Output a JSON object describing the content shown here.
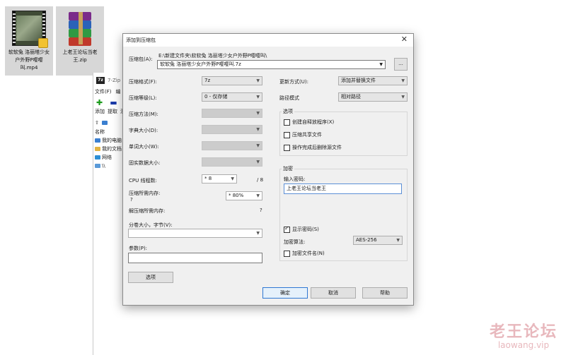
{
  "desktop": {
    "icons": [
      {
        "label": "软软兔 洛丽塔少女户外野P嘤嘤叫.mp4",
        "type": "video-file-icon"
      },
      {
        "label": "上老王论坛当老王.zip",
        "type": "winrar-archive-icon"
      }
    ]
  },
  "zip_window": {
    "title": "7-Zip",
    "menu": [
      "文件(F)",
      "编"
    ],
    "toolbar_labels": [
      "添加",
      "提取",
      "测"
    ],
    "address": "",
    "list_header": "名称",
    "items": [
      "我的电脑",
      "我的文档",
      "网络",
      "\\\\"
    ]
  },
  "dialog": {
    "title": "添加到压缩包",
    "archive_label": "压缩包(A):",
    "archive_path": "E:\\新建文件夹\\软软兔 洛丽塔少女户外野P嘤嘤叫\\",
    "archive_name": "软软兔 洛丽塔少女户外野P嘤嘤叫.7z",
    "browse_label": "...",
    "left": {
      "format_label": "压缩格式(F):",
      "format_value": "7z",
      "level_label": "压缩等级(L):",
      "level_value": "0 - 仅存储",
      "method_label": "压缩方法(M):",
      "dict_label": "字典大小(D):",
      "word_label": "单词大小(W):",
      "solid_label": "固实数据大小:",
      "threads_label": "CPU 线程数:",
      "threads_value": "* 8",
      "threads_max": "/ 8",
      "mem_label": "压缩所需内存:",
      "mem_q": "?",
      "mem_value": "* 80%",
      "decomp_label": "解压缩所需内存:",
      "decomp_q": "?",
      "split_label": "分卷大小，字节(V):",
      "params_label": "参数(P):",
      "options_button": "选项"
    },
    "right": {
      "update_label": "更新方式(U):",
      "update_value": "添加并替换文件",
      "path_label": "路径模式",
      "path_value": "相对路径",
      "options_group": "选项",
      "opt_sfx": "创建自释放程序(X)",
      "opt_shared": "压缩共享文件",
      "opt_delete": "操作完成后删除源文件",
      "encrypt_group": "加密",
      "password_label": "输入密码:",
      "password_value": "上老王论坛当老王",
      "show_password": "显示密码(S)",
      "enc_method_label": "加密算法:",
      "enc_method_value": "AES-256",
      "encrypt_names": "加密文件名(N)"
    },
    "buttons": {
      "ok": "确定",
      "cancel": "取消",
      "help": "帮助"
    }
  },
  "watermark": {
    "cn": "老王论坛",
    "en": "laowang.vip"
  }
}
